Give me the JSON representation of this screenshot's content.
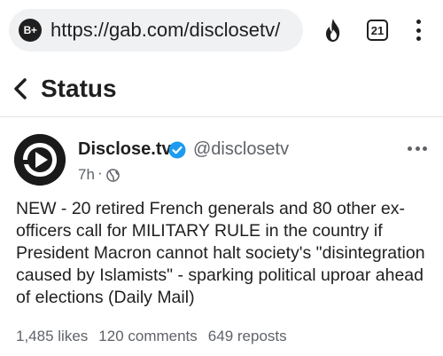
{
  "browser": {
    "site_badge": "B+",
    "url": "https://gab.com/disclosetv/",
    "tab_count": "21",
    "icons": [
      "flame-icon",
      "tab-count",
      "kebab-menu-icon"
    ]
  },
  "header": {
    "title": "Status",
    "back_icon": "chevron-left-icon"
  },
  "post": {
    "author_name": "Disclose.tv",
    "author_handle": "@disclosetv",
    "verified": true,
    "time": "7h",
    "time_separator": "·",
    "visibility_icon": "globe-icon",
    "body": "NEW - 20 retired French generals and 80 other ex-officers call for MILITARY RULE in the country if President Macron cannot halt society's \"disintegration caused by Islamists\" - sparking political uproar ahead of elections (Daily Mail)",
    "stats": {
      "likes": "1,485 likes",
      "comments": "120 comments",
      "reposts": "649 reposts"
    }
  },
  "colors": {
    "verified_blue": "#1d9bf0",
    "text": "#1f1f1f",
    "muted": "#5f6368",
    "url_bar_bg": "#eff1f3"
  }
}
